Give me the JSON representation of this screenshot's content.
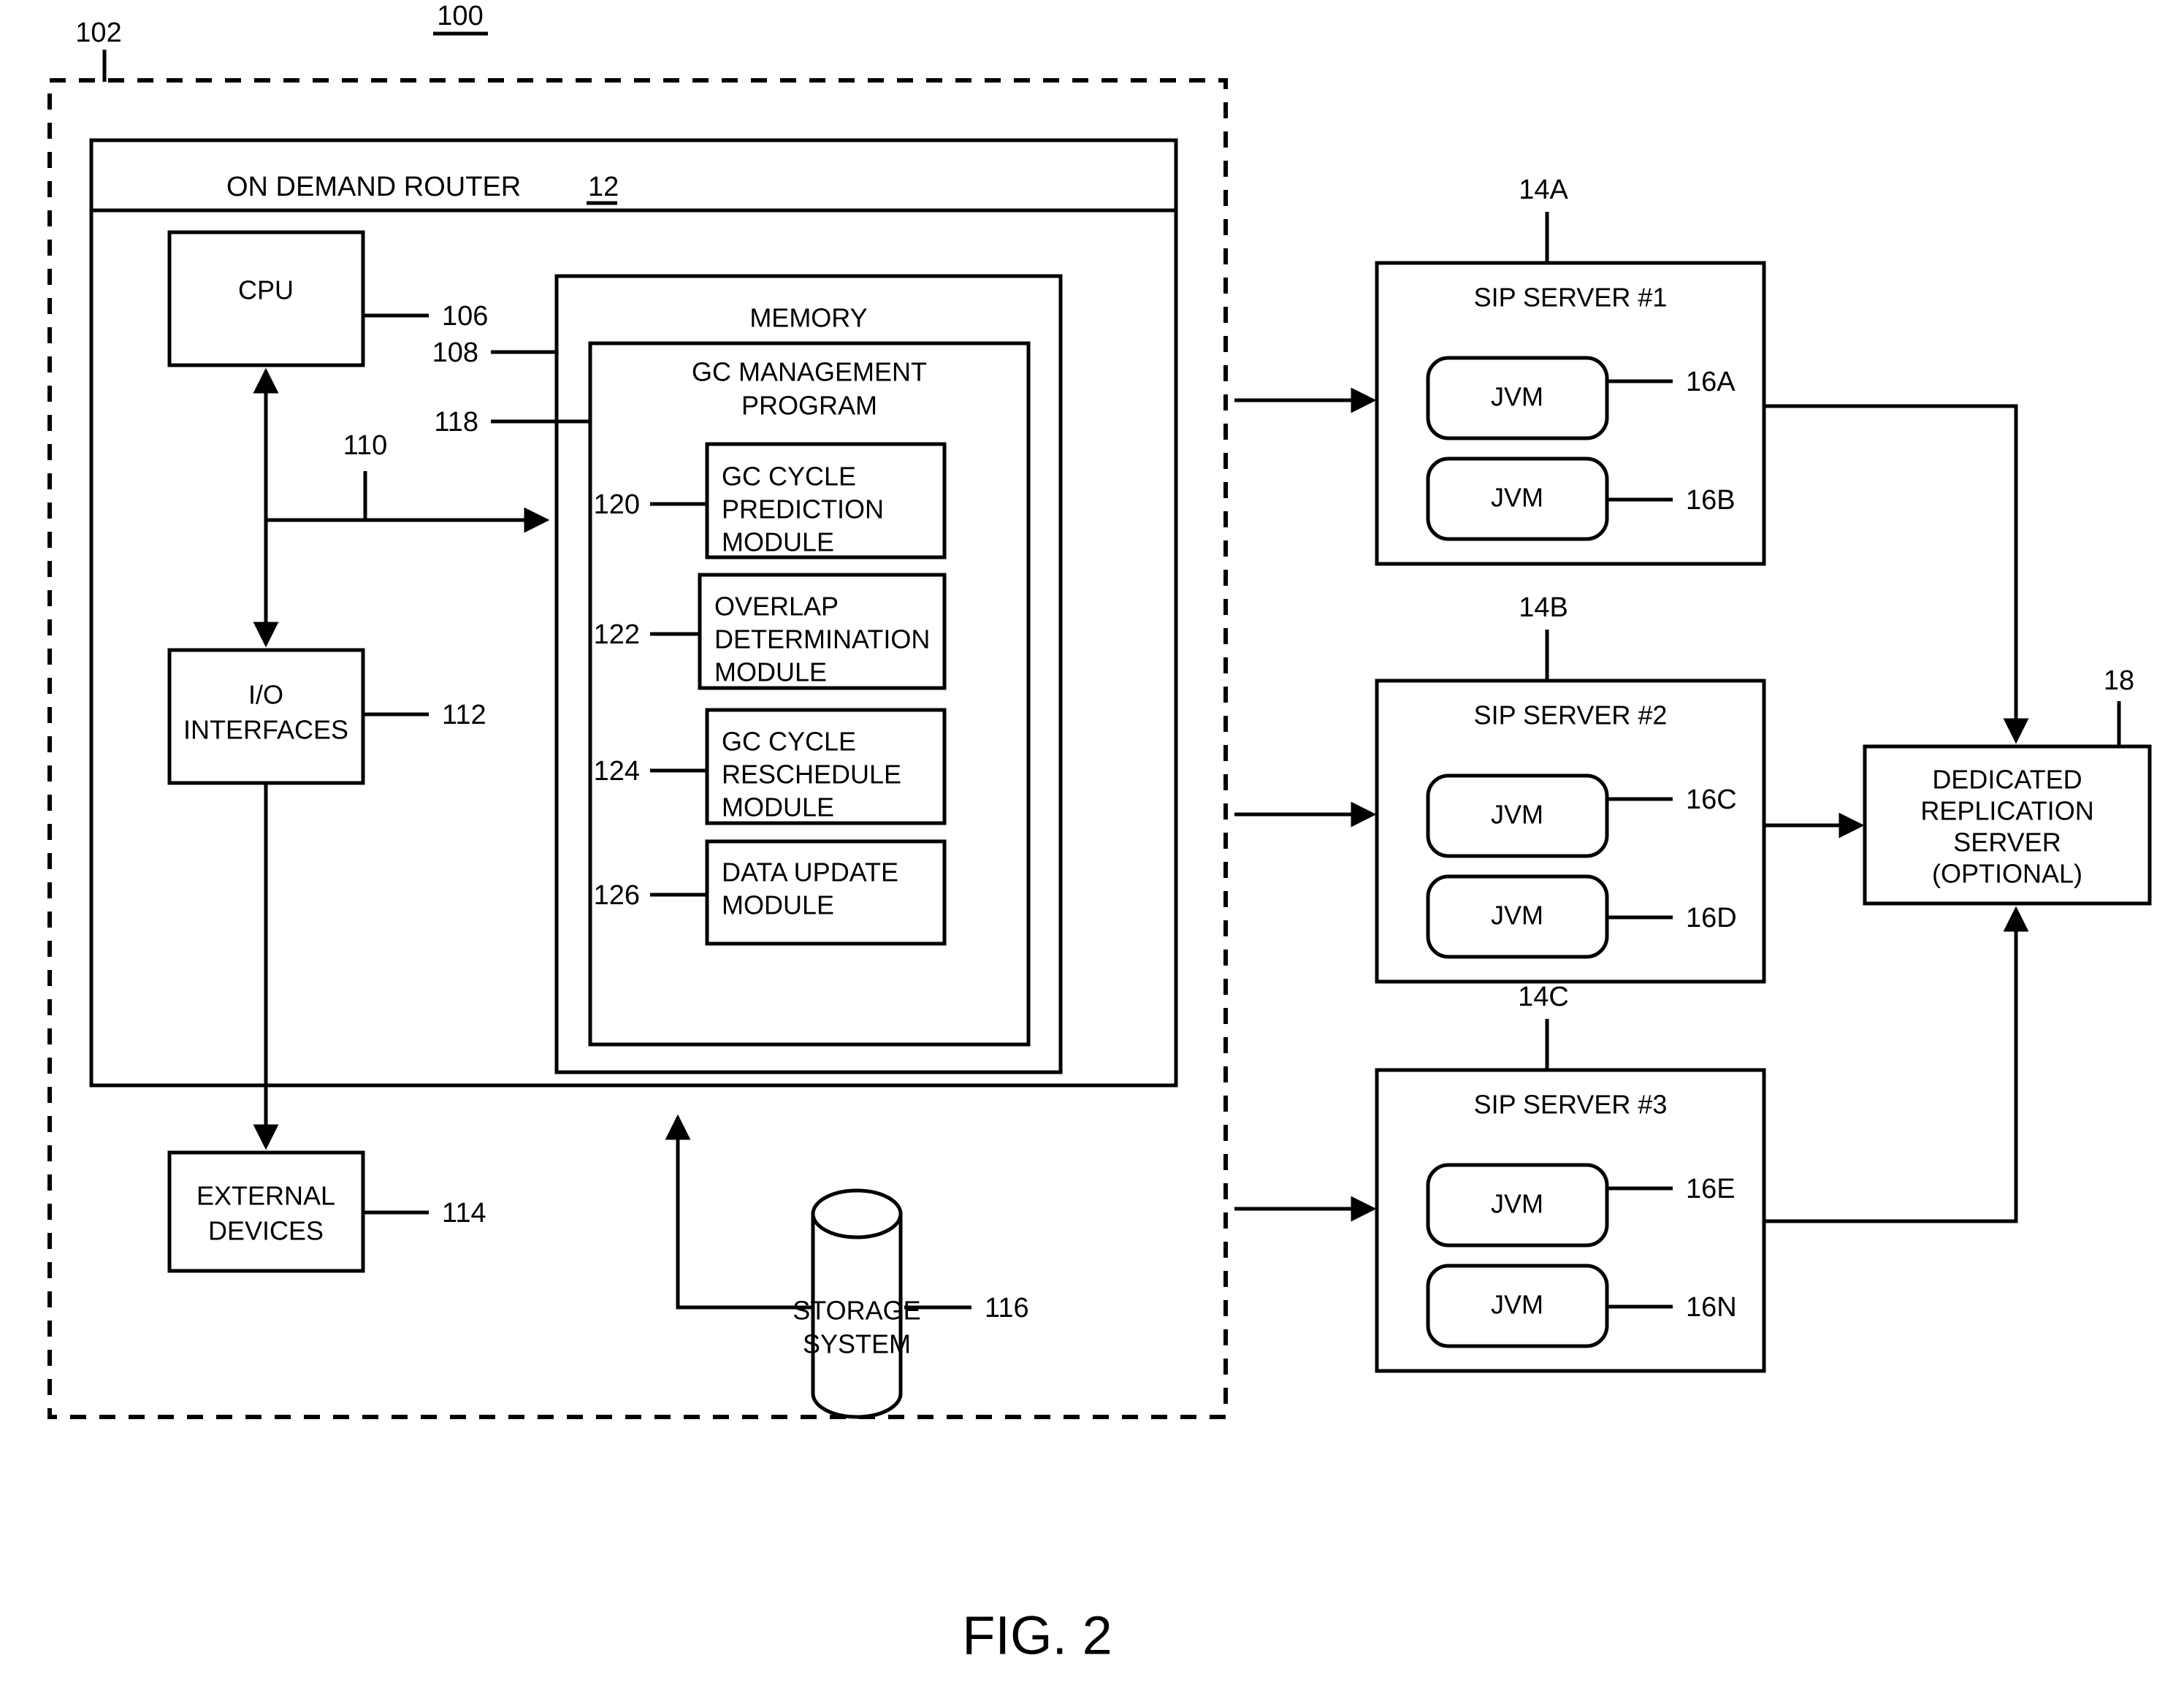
{
  "figure": {
    "caption": "FIG. 2",
    "system_ref": "100",
    "cloud_boundary_ref": "102"
  },
  "on_demand_router": {
    "title": "ON DEMAND ROUTER",
    "ref": "12",
    "cpu": {
      "label": "CPU",
      "ref": "106"
    },
    "bus": {
      "ref": "110"
    },
    "io_interfaces": {
      "label": "I/O INTERFACES",
      "line1": "I/O",
      "line2": "INTERFACES",
      "ref": "112"
    },
    "external_devices": {
      "label": "EXTERNAL DEVICES",
      "line1": "EXTERNAL",
      "line2": "DEVICES",
      "ref": "114"
    },
    "memory": {
      "label": "MEMORY",
      "ref": "108"
    },
    "gc_management_program": {
      "line1": "GC MANAGEMENT",
      "line2": "PROGRAM",
      "ref": "118",
      "modules": [
        {
          "ref": "120",
          "lines": [
            "GC CYCLE",
            "PREDICTION",
            "MODULE"
          ]
        },
        {
          "ref": "122",
          "lines": [
            "OVERLAP",
            "DETERMINATION",
            "MODULE"
          ]
        },
        {
          "ref": "124",
          "lines": [
            "GC CYCLE",
            "RESCHEDULE",
            "MODULE"
          ]
        },
        {
          "ref": "126",
          "lines": [
            "DATA UPDATE",
            "MODULE"
          ]
        }
      ]
    }
  },
  "storage_system": {
    "line1": "STORAGE",
    "line2": "SYSTEM",
    "ref": "116"
  },
  "sip_servers": [
    {
      "title": "SIP SERVER #1",
      "ref": "14A",
      "jvms": [
        {
          "label": "JVM",
          "ref": "16A"
        },
        {
          "label": "JVM",
          "ref": "16B"
        }
      ]
    },
    {
      "title": "SIP SERVER #2",
      "ref": "14B",
      "jvms": [
        {
          "label": "JVM",
          "ref": "16C"
        },
        {
          "label": "JVM",
          "ref": "16D"
        }
      ]
    },
    {
      "title": "SIP SERVER #3",
      "ref": "14C",
      "jvms": [
        {
          "label": "JVM",
          "ref": "16E"
        },
        {
          "label": "JVM",
          "ref": "16N"
        }
      ]
    }
  ],
  "replication_server": {
    "lines": [
      "DEDICATED",
      "REPLICATION",
      "SERVER",
      "(OPTIONAL)"
    ],
    "ref": "18"
  },
  "colors": {
    "ink": "#000000",
    "paper": "#ffffff"
  }
}
